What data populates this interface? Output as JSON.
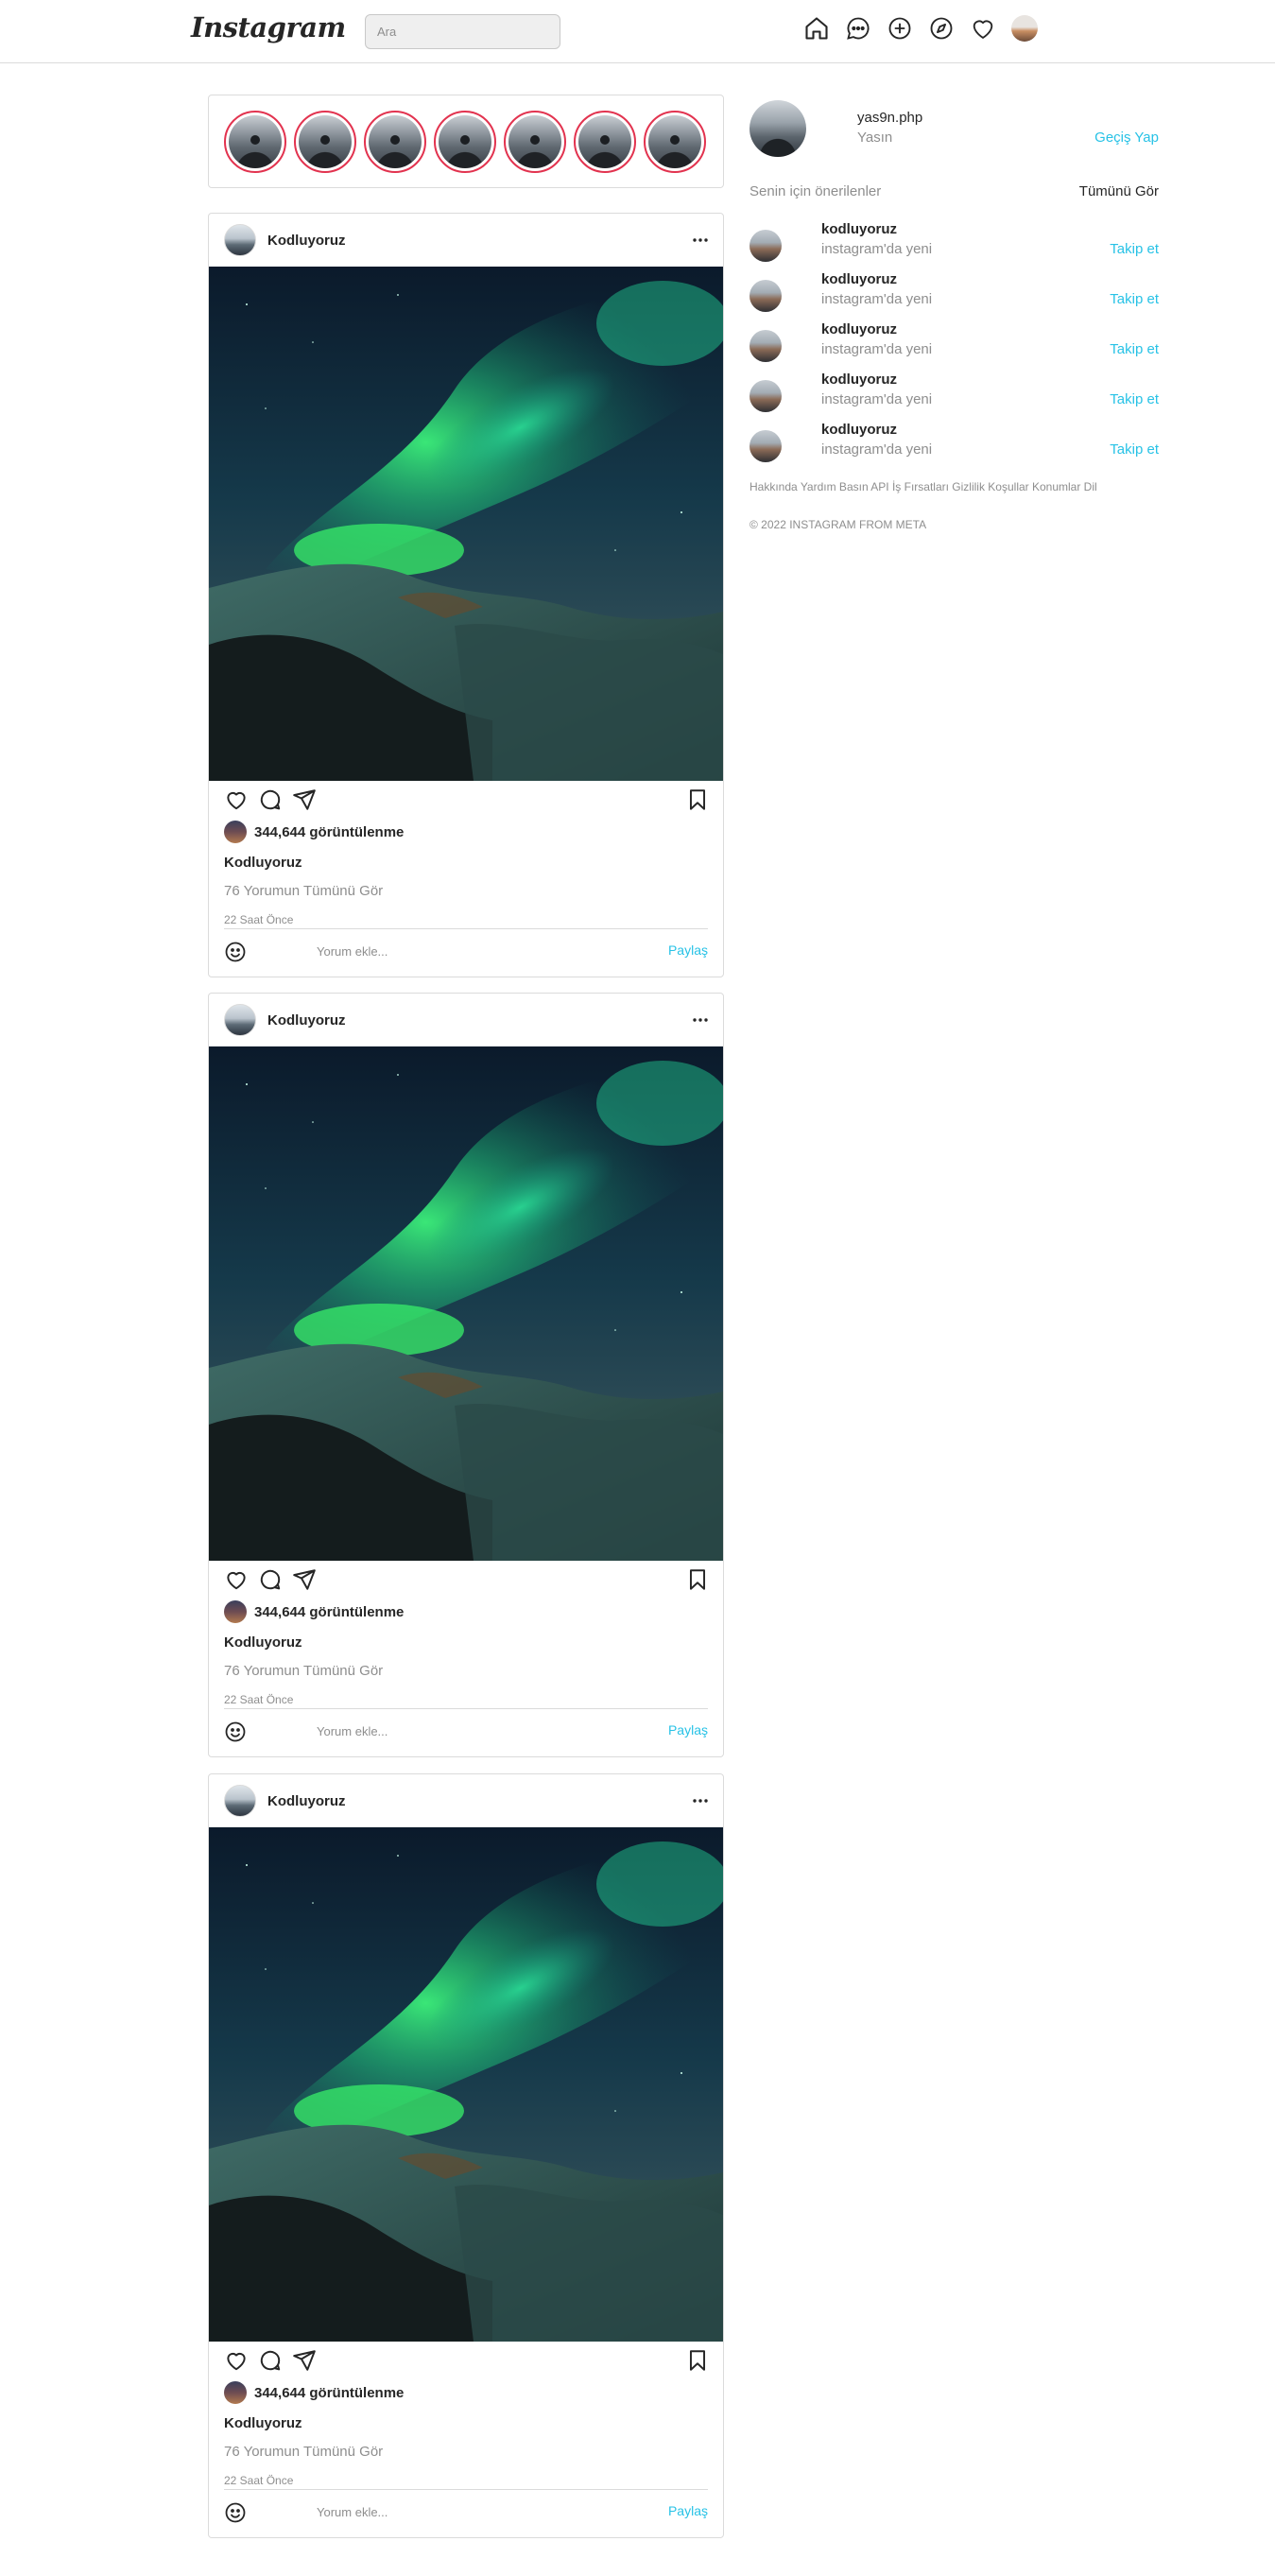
{
  "header": {
    "logo": "Instagram",
    "search_placeholder": "Ara",
    "icons": [
      "home-icon",
      "messenger-icon",
      "new-post-icon",
      "explore-icon",
      "activity-heart-icon",
      "profile-avatar"
    ]
  },
  "stories": {
    "count": 7,
    "ring_color": "#e2334f"
  },
  "posts": [
    {
      "username": "Kodluyoruz",
      "views": "344,644 görüntülenme",
      "caption_user": "Kodluyoruz",
      "comments_link": "76 Yorumun Tümünü Gör",
      "time": "22 Saat Önce",
      "comment_placeholder": "Yorum ekle...",
      "share_label": "Paylaş"
    },
    {
      "username": "Kodluyoruz",
      "views": "344,644 görüntülenme",
      "caption_user": "Kodluyoruz",
      "comments_link": "76 Yorumun Tümünü Gör",
      "time": "22 Saat Önce",
      "comment_placeholder": "Yorum ekle...",
      "share_label": "Paylaş"
    },
    {
      "username": "Kodluyoruz",
      "views": "344,644 görüntülenme",
      "caption_user": "Kodluyoruz",
      "comments_link": "76 Yorumun Tümünü Gör",
      "time": "22 Saat Önce",
      "comment_placeholder": "Yorum ekle...",
      "share_label": "Paylaş"
    }
  ],
  "sidebar": {
    "username": "yas9n.php",
    "name": "Yasın",
    "switch_label": "Geçiş Yap",
    "suggestions_title": "Senin için önerilenler",
    "see_all_label": "Tümünü Gör",
    "suggestions": [
      {
        "username": "kodluyoruz",
        "subtitle": "instagram'da yeni",
        "follow_label": "Takip et"
      },
      {
        "username": "kodluyoruz",
        "subtitle": "instagram'da yeni",
        "follow_label": "Takip et"
      },
      {
        "username": "kodluyoruz",
        "subtitle": "instagram'da yeni",
        "follow_label": "Takip et"
      },
      {
        "username": "kodluyoruz",
        "subtitle": "instagram'da yeni",
        "follow_label": "Takip et"
      },
      {
        "username": "kodluyoruz",
        "subtitle": "instagram'da yeni",
        "follow_label": "Takip et"
      }
    ],
    "footer_links": "Hakkında Yardım Basın API İş Fırsatları Gizlilik Koşullar Konumlar Dil",
    "copyright": "© 2022 INSTAGRAM FROM META"
  },
  "colors": {
    "accent": "#27c2e6",
    "muted": "#8e8e8e",
    "border": "#dbdbdb",
    "story_ring": "#e2334f"
  }
}
